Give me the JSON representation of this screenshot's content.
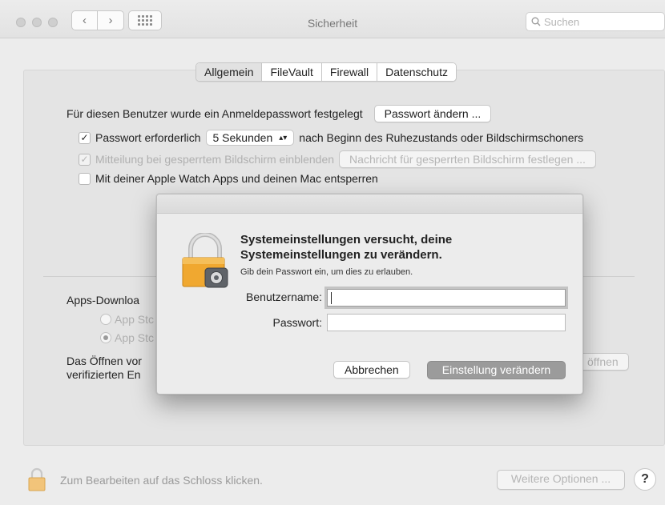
{
  "window": {
    "title": "Sicherheit",
    "search_placeholder": "Suchen"
  },
  "tabs": [
    "Allgemein",
    "FileVault",
    "Firewall",
    "Datenschutz"
  ],
  "general": {
    "password_set_text": "Für diesen Benutzer wurde ein Anmeldepasswort festgelegt",
    "change_password_button": "Passwort ändern ...",
    "require_password_label": "Passwort erforderlich",
    "require_password_delay": "5 Sekunden",
    "require_password_suffix": "nach Beginn des Ruhezustands oder Bildschirmschoners",
    "show_message_label": "Mitteilung bei gesperrtem Bildschirm einblenden",
    "set_message_button": "Nachricht für gesperrten Bildschirm festlegen ...",
    "apple_watch_label": "Mit deiner Apple Watch Apps und deinen Mac entsperren"
  },
  "downloads": {
    "heading": "Apps-Downloa",
    "option1": "App Stc",
    "option2": "App Stc",
    "open_text_line1": "Das Öffnen vor",
    "open_text_line2": "verifizierten En",
    "open_button": "öffnen"
  },
  "bottom": {
    "lock_text": "Zum Bearbeiten auf das Schloss klicken.",
    "more_options": "Weitere Optionen ...",
    "help": "?"
  },
  "dialog": {
    "title": "Systemeinstellungen versucht, deine Systemeinstellungen zu verändern.",
    "subtitle": "Gib dein Passwort ein, um dies zu erlauben.",
    "username_label": "Benutzername:",
    "username_value": "",
    "password_label": "Passwort:",
    "password_value": "",
    "cancel_button": "Abbrechen",
    "ok_button": "Einstellung verändern"
  },
  "icons": {
    "back": "chevron-left-icon",
    "forward": "chevron-right-icon",
    "grid": "grid-icon",
    "search": "search-icon",
    "lock": "lock-icon",
    "stepper": "chevron-updown-icon",
    "check": "checkmark-icon"
  },
  "colors": {
    "lock_gold": "#f0a830",
    "default_button_disabled": "#9b9b9b"
  }
}
